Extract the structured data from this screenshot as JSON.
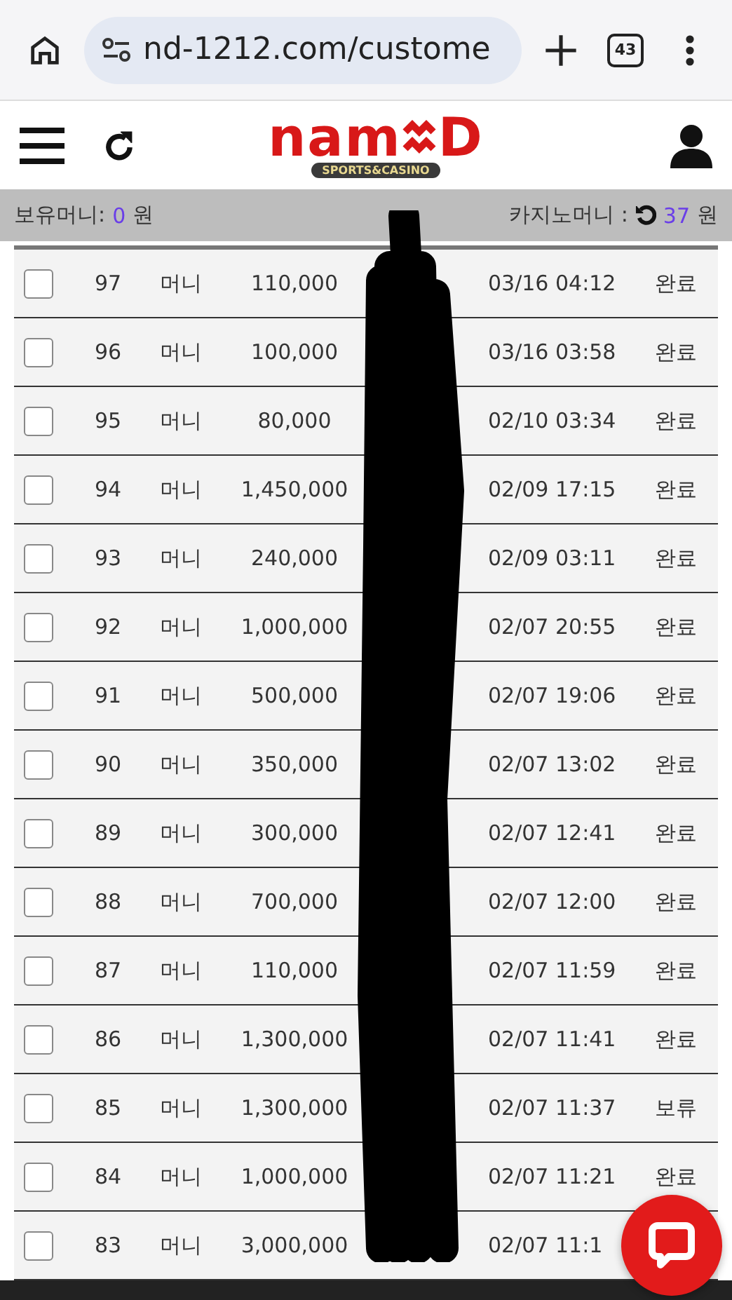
{
  "browser": {
    "url": "nd-1212.com/custome",
    "tab_count": "43"
  },
  "header": {
    "logo": {
      "left": "nam",
      "right": "D",
      "tagline": "SPORTS&CASINO"
    }
  },
  "balance": {
    "label": "보유머니:",
    "amount": "0",
    "unit": "원",
    "casino_label": "카지노머니 :",
    "casino_amount": "37",
    "casino_unit": "원"
  },
  "rows": [
    {
      "checked": false,
      "no": "97",
      "type": "머니",
      "amount": "110,000",
      "date": "03/16 04:12",
      "status": "완료"
    },
    {
      "checked": false,
      "no": "96",
      "type": "머니",
      "amount": "100,000",
      "date": "03/16 03:58",
      "status": "완료"
    },
    {
      "checked": false,
      "no": "95",
      "type": "머니",
      "amount": "80,000",
      "date": "02/10 03:34",
      "status": "완료"
    },
    {
      "checked": false,
      "no": "94",
      "type": "머니",
      "amount": "1,450,000",
      "date": "02/09 17:15",
      "status": "완료"
    },
    {
      "checked": false,
      "no": "93",
      "type": "머니",
      "amount": "240,000",
      "date": "02/09 03:11",
      "status": "완료"
    },
    {
      "checked": false,
      "no": "92",
      "type": "머니",
      "amount": "1,000,000",
      "date": "02/07 20:55",
      "status": "완료"
    },
    {
      "checked": false,
      "no": "91",
      "type": "머니",
      "amount": "500,000",
      "date": "02/07 19:06",
      "status": "완료"
    },
    {
      "checked": false,
      "no": "90",
      "type": "머니",
      "amount": "350,000",
      "date": "02/07 13:02",
      "status": "완료"
    },
    {
      "checked": false,
      "no": "89",
      "type": "머니",
      "amount": "300,000",
      "date": "02/07 12:41",
      "status": "완료"
    },
    {
      "checked": false,
      "no": "88",
      "type": "머니",
      "amount": "700,000",
      "date": "02/07 12:00",
      "status": "완료"
    },
    {
      "checked": false,
      "no": "87",
      "type": "머니",
      "amount": "110,000",
      "date": "02/07 11:59",
      "status": "완료"
    },
    {
      "checked": false,
      "no": "86",
      "type": "머니",
      "amount": "1,300,000",
      "date": "02/07 11:41",
      "status": "완료"
    },
    {
      "checked": false,
      "no": "85",
      "type": "머니",
      "amount": "1,300,000",
      "date": "02/07 11:37",
      "status": "보류"
    },
    {
      "checked": false,
      "no": "84",
      "type": "머니",
      "amount": "1,000,000",
      "date": "02/07 11:21",
      "status": "완료"
    },
    {
      "checked": false,
      "no": "83",
      "type": "머니",
      "amount": "3,000,000",
      "date": "02/07 11:1"
    }
  ]
}
